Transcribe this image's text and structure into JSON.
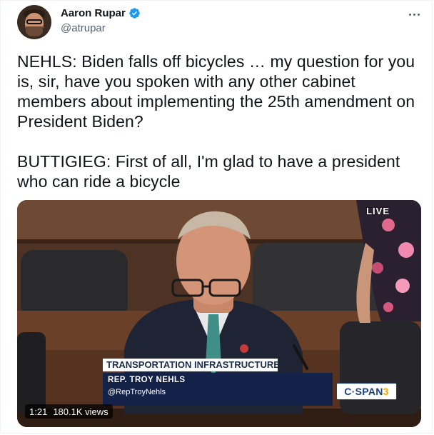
{
  "tweet": {
    "author_name": "Aaron Rupar",
    "author_handle": "@atrupar",
    "text": "NEHLS: Biden falls off bicycles … my question for you is, sir, have you spoken with any other cabinet members about implementing the 25th amendment on President Biden?\n\nBUTTIGIEG: First of all, I'm glad to have a president who can ride a bicycle"
  },
  "media": {
    "live_label": "LIVE",
    "lower_third_title": "TRANSPORTATION INFRASTRUCTURE",
    "lower_third_name": "REP. TROY NEHLS",
    "lower_third_handle": "@RepTroyNehls",
    "network_logo_main": "C·SPAN",
    "network_logo_number": "3",
    "duration": "1:21",
    "views": "180.1K views"
  },
  "icons": {
    "verified": "verified-badge-icon",
    "more": "more-options-icon"
  },
  "colors": {
    "verified_blue": "#1d9bf0",
    "text_primary": "#0f1419",
    "text_secondary": "#536471",
    "cspan_blue": "#1d3f7a",
    "cspan_yellow": "#f2a900"
  }
}
